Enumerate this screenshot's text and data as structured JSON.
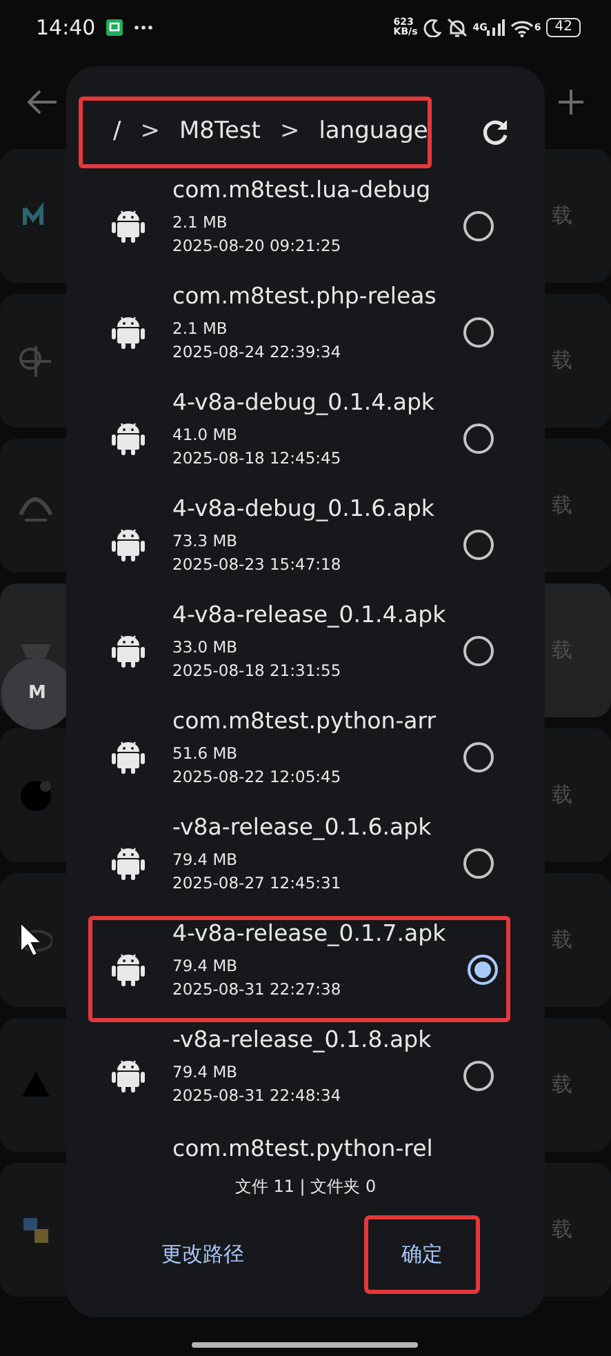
{
  "status_bar": {
    "time": "14:40",
    "net_speed_value": "623",
    "net_speed_unit": "KB/s",
    "network": "4G",
    "wifi_band": "6",
    "battery": "42"
  },
  "background_cards": [
    {
      "action": "载",
      "highlighted": false
    },
    {
      "action": "载",
      "highlighted": false
    },
    {
      "action": "载",
      "highlighted": false
    },
    {
      "action": "载",
      "highlighted": true
    },
    {
      "action": "载",
      "highlighted": false
    },
    {
      "action": "载",
      "highlighted": false
    },
    {
      "action": "载",
      "highlighted": false
    },
    {
      "action": "载",
      "highlighted": false
    }
  ],
  "floating_button": {
    "label": "M"
  },
  "dialog": {
    "breadcrumb": [
      {
        "kind": "folder",
        "label": "/"
      },
      {
        "kind": "separator",
        "label": ">"
      },
      {
        "kind": "folder",
        "label": "M8Test"
      },
      {
        "kind": "separator",
        "label": ">"
      },
      {
        "kind": "folder",
        "label": "language"
      }
    ],
    "breadcrumb_annotated": true,
    "files": [
      {
        "name": "com.m8test.lua-debug",
        "size": "2.1 MB",
        "modified": "2025-08-20 09:21:25",
        "selected": false,
        "annotated": false
      },
      {
        "name": "com.m8test.php-releas",
        "size": "2.1 MB",
        "modified": "2025-08-24 22:39:34",
        "selected": false,
        "annotated": false
      },
      {
        "name": "4-v8a-debug_0.1.4.apk",
        "size": "41.0 MB",
        "modified": "2025-08-18 12:45:45",
        "selected": false,
        "annotated": false
      },
      {
        "name": "4-v8a-debug_0.1.6.apk",
        "size": "73.3 MB",
        "modified": "2025-08-23 15:47:18",
        "selected": false,
        "annotated": false
      },
      {
        "name": "4-v8a-release_0.1.4.apk",
        "size": "33.0 MB",
        "modified": "2025-08-18 21:31:55",
        "selected": false,
        "annotated": false
      },
      {
        "name": "com.m8test.python-arr",
        "size": "51.6 MB",
        "modified": "2025-08-22 12:05:45",
        "selected": false,
        "annotated": false
      },
      {
        "name": "-v8a-release_0.1.6.apk",
        "size": "79.4 MB",
        "modified": "2025-08-27 12:45:31",
        "selected": false,
        "annotated": false
      },
      {
        "name": "4-v8a-release_0.1.7.apk",
        "size": "79.4 MB",
        "modified": "2025-08-31 22:27:38",
        "selected": true,
        "annotated": true
      },
      {
        "name": "-v8a-release_0.1.8.apk",
        "size": "79.4 MB",
        "modified": "2025-08-31 22:48:34",
        "selected": false,
        "annotated": false
      },
      {
        "name": "com.m8test.python-rel"
      }
    ],
    "summary": "文件 11 | 文件夹 0",
    "buttons": [
      {
        "label": "更改路径",
        "annotated": false
      },
      {
        "label": "确定",
        "annotated": true
      }
    ]
  }
}
